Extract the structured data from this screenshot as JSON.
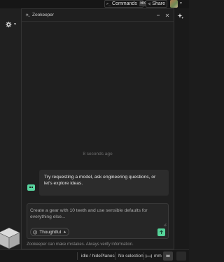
{
  "topbar": {
    "commands_label": "Commands",
    "commands_shortcut": "⌘K",
    "share_label": "Share"
  },
  "panel": {
    "title": "Zookeeper",
    "timestamp": "8 seconds ago",
    "assistant_message": "Try requesting a model, ask engineering questions, or let's explore ideas.",
    "input_placeholder": "Create a gear with 10 teeth and use sensible defaults for everything else...",
    "mode_label": "Thoughtful",
    "disclaimer": "Zookeeper can make mistakes. Always verify information."
  },
  "statusbar": {
    "command_path": "idle / hidePlanes",
    "selection": "No selection",
    "units": "mm",
    "infinity_symbol": "∞"
  },
  "colors": {
    "accent_green": "#56d49a",
    "panel_bg": "#1f1f1f",
    "app_bg": "#1c1c1c"
  }
}
